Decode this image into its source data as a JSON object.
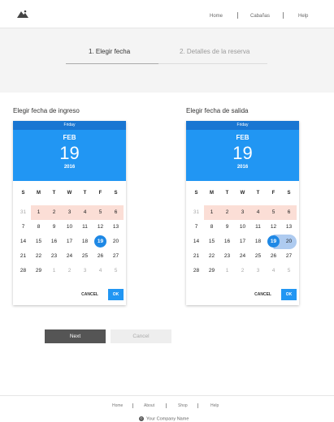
{
  "header": {
    "nav": [
      "Home",
      "Cabañas",
      "Help"
    ]
  },
  "steps": {
    "step1": "1. Elegir fecha",
    "step2": "2. Detalles de la reserva"
  },
  "checkin": {
    "title": "Elegir fecha de ingreso",
    "day_name": "Friday",
    "month": "FEB",
    "date": "19",
    "year": "2016",
    "weekdays": [
      "S",
      "M",
      "T",
      "W",
      "T",
      "F",
      "S"
    ],
    "cancel_label": "CANCEL",
    "ok_label": "OK"
  },
  "checkout": {
    "title": "Elegir fecha de salida",
    "day_name": "Friday",
    "month": "FEB",
    "date": "19",
    "year": "2016",
    "weekdays": [
      "S",
      "M",
      "T",
      "W",
      "T",
      "F",
      "S"
    ],
    "cancel_label": "CANCEL",
    "ok_label": "OK"
  },
  "calendar_rows": [
    [
      "31",
      "1",
      "2",
      "3",
      "4",
      "5",
      "6"
    ],
    [
      "7",
      "8",
      "9",
      "10",
      "11",
      "12",
      "13"
    ],
    [
      "14",
      "15",
      "16",
      "17",
      "18",
      "19",
      "20"
    ],
    [
      "21",
      "22",
      "23",
      "24",
      "25",
      "26",
      "27"
    ],
    [
      "28",
      "29",
      "1",
      "2",
      "3",
      "4",
      "5"
    ]
  ],
  "buttons": {
    "next": "Next",
    "cancel": "Cancel"
  },
  "footer": {
    "links": [
      "Home",
      "About",
      "Shop",
      "Help"
    ],
    "copyright_symbol": "©",
    "company": "Your Company Name"
  }
}
